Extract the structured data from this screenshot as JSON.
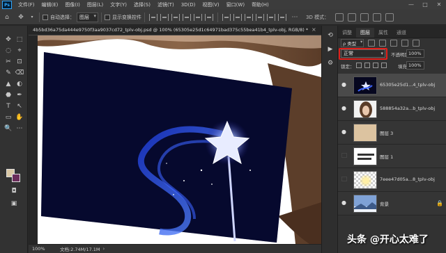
{
  "menubar": {
    "logo": "Ps",
    "items": [
      "文件(F)",
      "编辑(E)",
      "图像(I)",
      "图层(L)",
      "文字(Y)",
      "选择(S)",
      "滤镜(T)",
      "3D(D)",
      "视图(V)",
      "窗口(W)",
      "帮助(H)"
    ],
    "minimize": "—",
    "maximize": "□",
    "close": "✕"
  },
  "options": {
    "auto_select_label": "自动选择：",
    "auto_select_value": "图层",
    "transform_controls_label": "显示变换控件",
    "mode3d_label": "3D 模式："
  },
  "toolbar": {
    "tools": [
      "✥",
      "⬚",
      "◌",
      "⌖",
      "✂",
      "⊡",
      "✎",
      "⌫",
      "▲",
      "◐",
      "⬣",
      "✒",
      "T",
      "↖",
      "▭",
      "✋",
      "🔍",
      "⋯"
    ],
    "fg_color": "#d9c7a4",
    "bg_color": "#6a2c5a"
  },
  "document": {
    "tab_title": "4b5bd36a75da444e9750f3aa9037cd72_tplv-obj.psd @ 100% (65305e25d1c64971bad375c55bea41b4_tplv-obj, RGB/8) *",
    "tab_close": "×"
  },
  "status": {
    "zoom": "100%",
    "doc_info": "文档:2.74M/17.1M",
    "arrow": "›"
  },
  "layers_panel": {
    "tabs": [
      "调整",
      "图层",
      "属性",
      "通道"
    ],
    "active_tab": 1,
    "filter_kind": "ρ 类型",
    "blend_mode": "正常",
    "opacity_label": "不透明度：",
    "opacity_value": "100%",
    "lock_label": "锁定：",
    "fill_label": "填充：",
    "fill_value": "100%",
    "layers": [
      {
        "name": "65305e25d1...4_tplv-obj",
        "visible": true,
        "selected": true
      },
      {
        "name": "588854a32a...b_tplv-obj",
        "visible": true,
        "selected": false
      },
      {
        "name": "图层 3",
        "visible": true,
        "selected": false
      },
      {
        "name": "图层 1",
        "visible": false,
        "selected": false
      },
      {
        "name": "7eee47d05a...8_tplv-obj",
        "visible": false,
        "selected": false
      },
      {
        "name": "背景",
        "visible": true,
        "selected": false,
        "locked": true
      }
    ]
  },
  "watermark": "头条 @开心太难了",
  "colors": {
    "accent_highlight": "#e3201b",
    "canvas_dark": "#050828",
    "layer_tan": "#dcc3a0"
  }
}
